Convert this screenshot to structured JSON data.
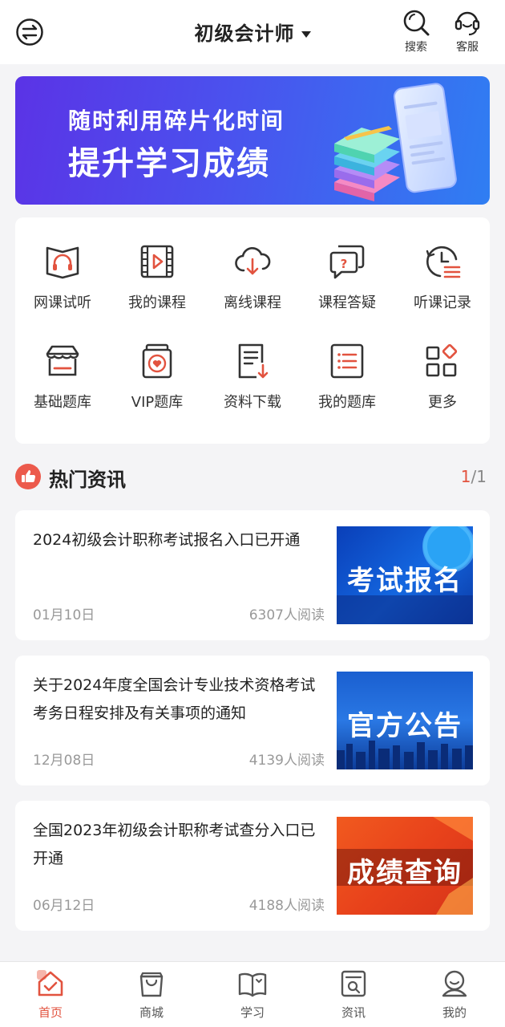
{
  "header": {
    "title": "初级会计师",
    "search_label": "搜索",
    "service_label": "客服"
  },
  "banner": {
    "line1": "随时利用碎片化时间",
    "line2": "提升学习成绩"
  },
  "grid": [
    {
      "label": "网课试听",
      "icon": "headphone-book-icon"
    },
    {
      "label": "我的课程",
      "icon": "video-play-icon"
    },
    {
      "label": "离线课程",
      "icon": "cloud-download-icon"
    },
    {
      "label": "课程答疑",
      "icon": "question-chat-icon"
    },
    {
      "label": "听课记录",
      "icon": "history-clock-icon"
    },
    {
      "label": "基础题库",
      "icon": "store-icon"
    },
    {
      "label": "VIP题库",
      "icon": "vip-heart-icon"
    },
    {
      "label": "资料下载",
      "icon": "document-download-icon"
    },
    {
      "label": "我的题库",
      "icon": "list-icon"
    },
    {
      "label": "更多",
      "icon": "more-grid-icon"
    }
  ],
  "hot_news": {
    "title": "热门资讯",
    "page_current": "1",
    "page_total": "/1",
    "items": [
      {
        "title": "2024初级会计职称考试报名入口已开通",
        "date": "01月10日",
        "reads": "6307人阅读",
        "thumb_text": "考试报名"
      },
      {
        "title": "关于2024年度全国会计专业技术资格考试考务日程安排及有关事项的通知",
        "date": "12月08日",
        "reads": "4139人阅读",
        "thumb_text": "官方公告"
      },
      {
        "title": "全国2023年初级会计职称考试查分入口已开通",
        "date": "06月12日",
        "reads": "4188人阅读",
        "thumb_text": "成绩查询"
      }
    ]
  },
  "tabs": [
    {
      "label": "首页",
      "icon": "home-icon",
      "active": true
    },
    {
      "label": "商城",
      "icon": "shopping-bag-icon",
      "active": false
    },
    {
      "label": "学习",
      "icon": "open-book-icon",
      "active": false
    },
    {
      "label": "资讯",
      "icon": "news-search-icon",
      "active": false
    },
    {
      "label": "我的",
      "icon": "profile-icon",
      "active": false
    }
  ],
  "colors": {
    "accent": "#e2533f",
    "icon_red": "#e2533f",
    "icon_dark": "#333333"
  }
}
